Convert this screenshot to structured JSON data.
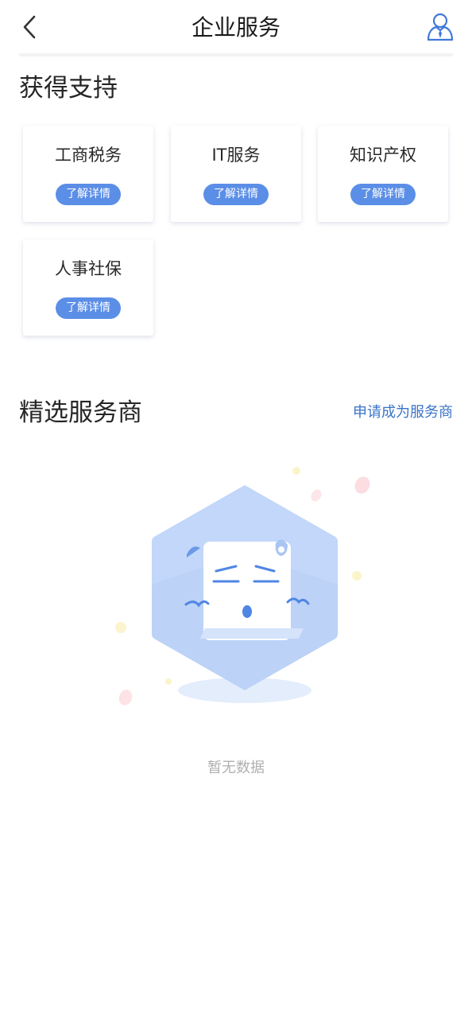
{
  "header": {
    "title": "企业服务",
    "back_icon": "chevron-left-icon",
    "profile_icon": "user-profile-icon"
  },
  "support": {
    "title": "获得支持",
    "cards": [
      {
        "label": "工商税务",
        "button": "了解详情"
      },
      {
        "label": "IT服务",
        "button": "了解详情"
      },
      {
        "label": "知识产权",
        "button": "了解详情"
      },
      {
        "label": "人事社保",
        "button": "了解详情"
      }
    ]
  },
  "providers": {
    "title": "精选服务商",
    "apply_link": "申请成为服务商",
    "empty_text": "暂无数据",
    "empty_icon": "empty-state-illustration"
  },
  "colors": {
    "accent": "#5b8ee6",
    "link": "#3a74c8",
    "muted": "#b0b0b0"
  }
}
